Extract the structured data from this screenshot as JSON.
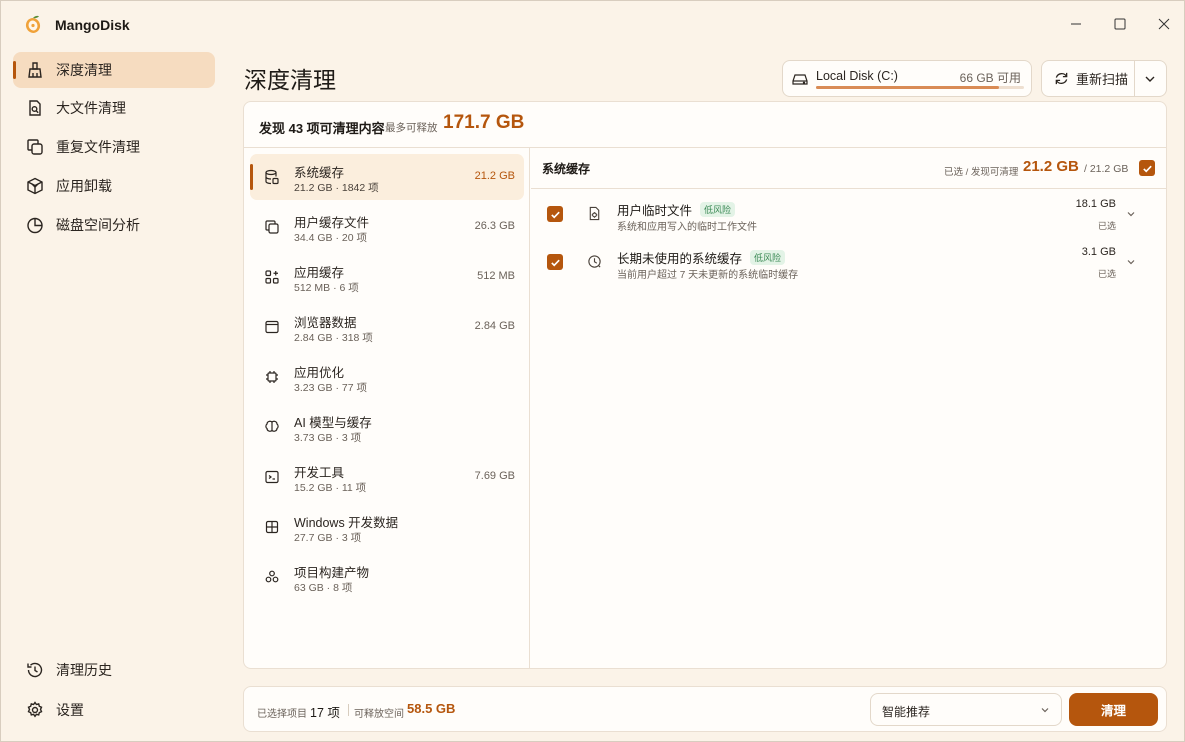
{
  "app": {
    "title": "MangoDisk"
  },
  "sidebar": {
    "items": [
      {
        "label": "深度清理",
        "icon": "broom-icon",
        "active": true
      },
      {
        "label": "大文件清理",
        "icon": "file-search-icon"
      },
      {
        "label": "重复文件清理",
        "icon": "copy-icon"
      },
      {
        "label": "应用卸载",
        "icon": "package-icon"
      },
      {
        "label": "磁盘空间分析",
        "icon": "pie-chart-icon"
      }
    ],
    "bottom": [
      {
        "label": "清理历史",
        "icon": "history-icon"
      },
      {
        "label": "设置",
        "icon": "gear-icon"
      }
    ]
  },
  "header": {
    "title": "深度清理",
    "disk": {
      "name": "Local Disk (C:)",
      "free": "66 GB 可用",
      "used_fraction": 0.88
    },
    "rescan_label": "重新扫描"
  },
  "summary": {
    "found": "发现 43 项可清理内容",
    "max_label": "最多可释放",
    "max_value": "171.7 GB"
  },
  "categories": [
    {
      "name": "系统缓存",
      "meta": "21.2 GB · 1842 项",
      "size": "21.2 GB",
      "icon": "database-icon"
    },
    {
      "name": "用户缓存文件",
      "meta": "34.4 GB · 20 项",
      "size": "26.3 GB",
      "icon": "layers-icon"
    },
    {
      "name": "应用缓存",
      "meta": "512 MB · 6 项",
      "size": "512 MB",
      "icon": "apps-icon"
    },
    {
      "name": "浏览器数据",
      "meta": "2.84 GB · 318 项",
      "size": "2.84 GB",
      "icon": "browser-icon"
    },
    {
      "name": "应用优化",
      "meta": "3.23 GB · 77 项",
      "size": "",
      "icon": "chip-icon"
    },
    {
      "name": "AI 模型与缓存",
      "meta": "3.73 GB · 3 项",
      "size": "",
      "icon": "ai-brain-icon"
    },
    {
      "name": "开发工具",
      "meta": "15.2 GB · 11 项",
      "size": "7.69 GB",
      "icon": "terminal-icon"
    },
    {
      "name": "Windows 开发数据",
      "meta": "27.7 GB · 3 项",
      "size": "",
      "icon": "windows-icon"
    },
    {
      "name": "项目构建产物",
      "meta": "63 GB · 8 项",
      "size": "",
      "icon": "cubes-icon"
    }
  ],
  "detail": {
    "title": "系统缓存",
    "sel_label": "已选 / 发现可清理",
    "sel_value": "21.2 GB",
    "sel_total": "/ 21.2 GB",
    "rows": [
      {
        "name": "用户临时文件",
        "risk": "低风险",
        "desc": "系统和应用写入的临时工作文件",
        "size": "18.1 GB",
        "state": "已选",
        "icon": "file-icon"
      },
      {
        "name": "长期未使用的系统缓存",
        "risk": "低风险",
        "desc": "当前用户超过 7 天未更新的系统临时缓存",
        "size": "3.1 GB",
        "state": "已选",
        "icon": "clock-icon"
      }
    ]
  },
  "footer": {
    "sel_label": "已选择项目",
    "sel_count": "17 项",
    "free_label": "可释放空间",
    "free_value": "58.5 GB",
    "mode": "智能推荐",
    "clean_label": "清理"
  },
  "colors": {
    "accent": "#b5560d",
    "background": "#fbf3e8",
    "active_nav": "#f6dcc0"
  }
}
